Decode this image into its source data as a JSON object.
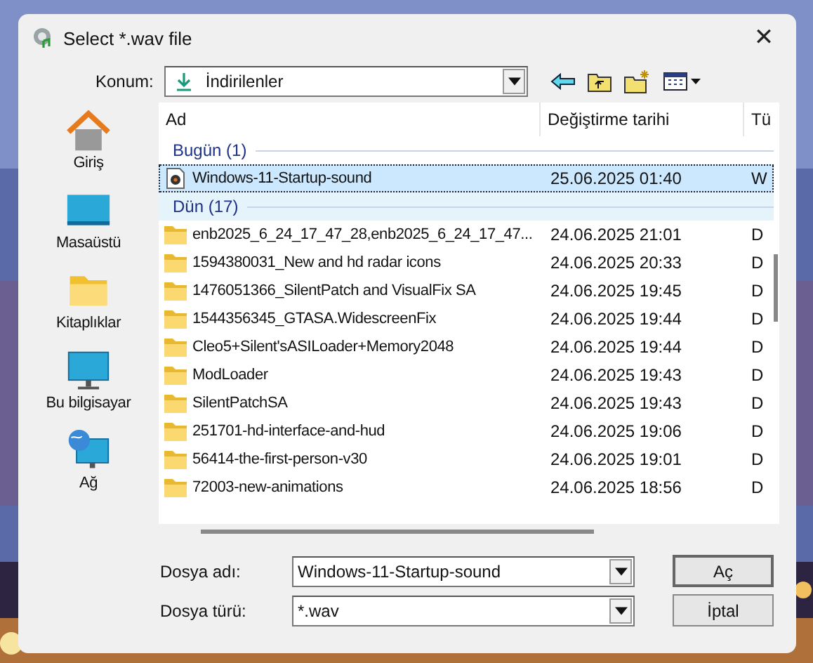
{
  "window": {
    "title": "Select *.wav file",
    "close": "✕"
  },
  "location": {
    "label": "Konum:",
    "value": "İndirilenler"
  },
  "places": [
    {
      "label": "Giriş",
      "kind": "home"
    },
    {
      "label": "Masaüstü",
      "kind": "desktop"
    },
    {
      "label": "Kitaplıklar",
      "kind": "library"
    },
    {
      "label": "Bu bilgisayar",
      "kind": "computer"
    },
    {
      "label": "Ağ",
      "kind": "network"
    }
  ],
  "columns": [
    "Ad",
    "Değiştirme tarihi",
    "Tü"
  ],
  "groups": [
    {
      "header": "Bugün (1)",
      "hovered": false,
      "rows": [
        {
          "kind": "audio",
          "name": "Windows-11-Startup-sound",
          "date": "25.06.2025 01:40",
          "type": "W",
          "selected": true
        }
      ]
    },
    {
      "header": "Dün (17)",
      "hovered": true,
      "rows": [
        {
          "kind": "folder",
          "name": "enb2025_6_24_17_47_28,enb2025_6_24_17_47...",
          "date": "24.06.2025 21:01",
          "type": "D",
          "selected": false
        },
        {
          "kind": "folder",
          "name": "1594380031_New and hd radar icons",
          "date": "24.06.2025 20:33",
          "type": "D",
          "selected": false
        },
        {
          "kind": "folder",
          "name": "1476051366_SilentPatch and VisualFix SA",
          "date": "24.06.2025 19:45",
          "type": "D",
          "selected": false
        },
        {
          "kind": "folder",
          "name": "1544356345_GTASA.WidescreenFix",
          "date": "24.06.2025 19:44",
          "type": "D",
          "selected": false
        },
        {
          "kind": "folder",
          "name": "Cleo5+Silent'sASILoader+Memory2048",
          "date": "24.06.2025 19:44",
          "type": "D",
          "selected": false
        },
        {
          "kind": "folder",
          "name": "ModLoader",
          "date": "24.06.2025 19:43",
          "type": "D",
          "selected": false
        },
        {
          "kind": "folder",
          "name": "SilentPatchSA",
          "date": "24.06.2025 19:43",
          "type": "D",
          "selected": false
        },
        {
          "kind": "folder",
          "name": "251701-hd-interface-and-hud",
          "date": "24.06.2025 19:06",
          "type": "D",
          "selected": false
        },
        {
          "kind": "folder",
          "name": "56414-the-first-person-v30",
          "date": "24.06.2025 19:01",
          "type": "D",
          "selected": false
        },
        {
          "kind": "folder",
          "name": "72003-new-animations",
          "date": "24.06.2025 18:56",
          "type": "D",
          "selected": false
        }
      ]
    }
  ],
  "filename": {
    "label": "Dosya adı:",
    "value": "Windows-11-Startup-sound"
  },
  "filetype": {
    "label": "Dosya türü:",
    "value": "*.wav"
  },
  "buttons": [
    "Aç",
    "İptal"
  ]
}
